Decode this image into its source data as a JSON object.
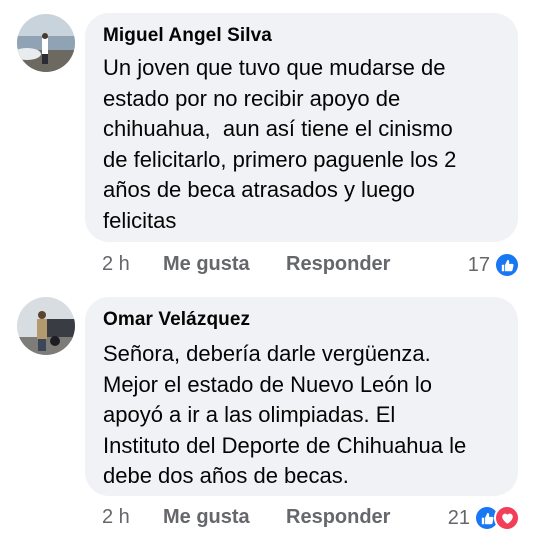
{
  "comments": [
    {
      "author": "Miguel Angel Silva",
      "text": "Un joven que tuvo que mudarse de\nestado por no recibir apoyo de\nchihuahua,  aun así tiene el cinismo\nde felicitarlo, primero paguenle los 2\naños de beca atrasados y luego\nfelicitas",
      "time": "2 h",
      "like_label": "Me gusta",
      "reply_label": "Responder",
      "reaction_count": "17",
      "reactions": [
        "like-icon"
      ]
    },
    {
      "author": "Omar Velázquez",
      "text": "Señora, debería darle vergüenza.\nMejor el estado de Nuevo León lo\napoyó a ir a las olimpiadas. El\nInstituto del Deporte de Chihuahua le\ndebe dos años de becas.",
      "time": "2 h",
      "like_label": "Me gusta",
      "reply_label": "Responder",
      "reaction_count": "21",
      "reactions": [
        "like-icon",
        "love-icon"
      ]
    }
  ],
  "colors": {
    "bubble": "#f0f2f5",
    "secondary_text": "#65676b",
    "like_blue": "#1877f2",
    "love_red": "#f33e58"
  }
}
